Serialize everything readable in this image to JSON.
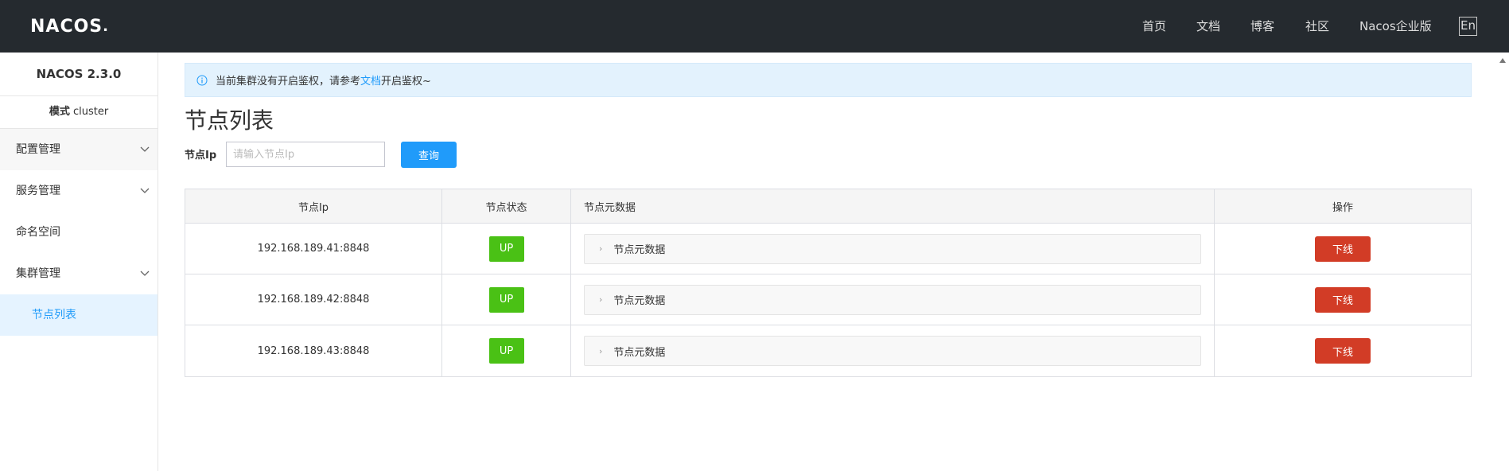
{
  "header": {
    "logo": "NACOS",
    "nav": [
      "首页",
      "文档",
      "博客",
      "社区",
      "Nacos企业版"
    ],
    "lang": "En"
  },
  "sidebar": {
    "version": "NACOS 2.3.0",
    "mode_label": "模式",
    "mode_value": "cluster",
    "items": [
      {
        "label": "配置管理"
      },
      {
        "label": "服务管理"
      },
      {
        "label": "命名空间"
      },
      {
        "label": "集群管理"
      },
      {
        "label": "节点列表"
      }
    ]
  },
  "alert": {
    "text_before": "当前集群没有开启鉴权，请参考",
    "link": "文档",
    "text_after": "开启鉴权~"
  },
  "page": {
    "title": "节点列表",
    "filter_label": "节点Ip",
    "filter_placeholder": "请输入节点Ip",
    "query_button": "查询"
  },
  "table": {
    "headers": [
      "节点Ip",
      "节点状态",
      "节点元数据",
      "操作"
    ],
    "rows": [
      {
        "ip": "192.168.189.41:8848",
        "status": "UP",
        "meta": "节点元数据",
        "action": "下线"
      },
      {
        "ip": "192.168.189.42:8848",
        "status": "UP",
        "meta": "节点元数据",
        "action": "下线"
      },
      {
        "ip": "192.168.189.43:8848",
        "status": "UP",
        "meta": "节点元数据",
        "action": "下线"
      }
    ]
  },
  "colors": {
    "header_bg": "#252a2f",
    "primary": "#209bfa",
    "up_green": "#4ac115",
    "offline_red": "#d23c26"
  }
}
